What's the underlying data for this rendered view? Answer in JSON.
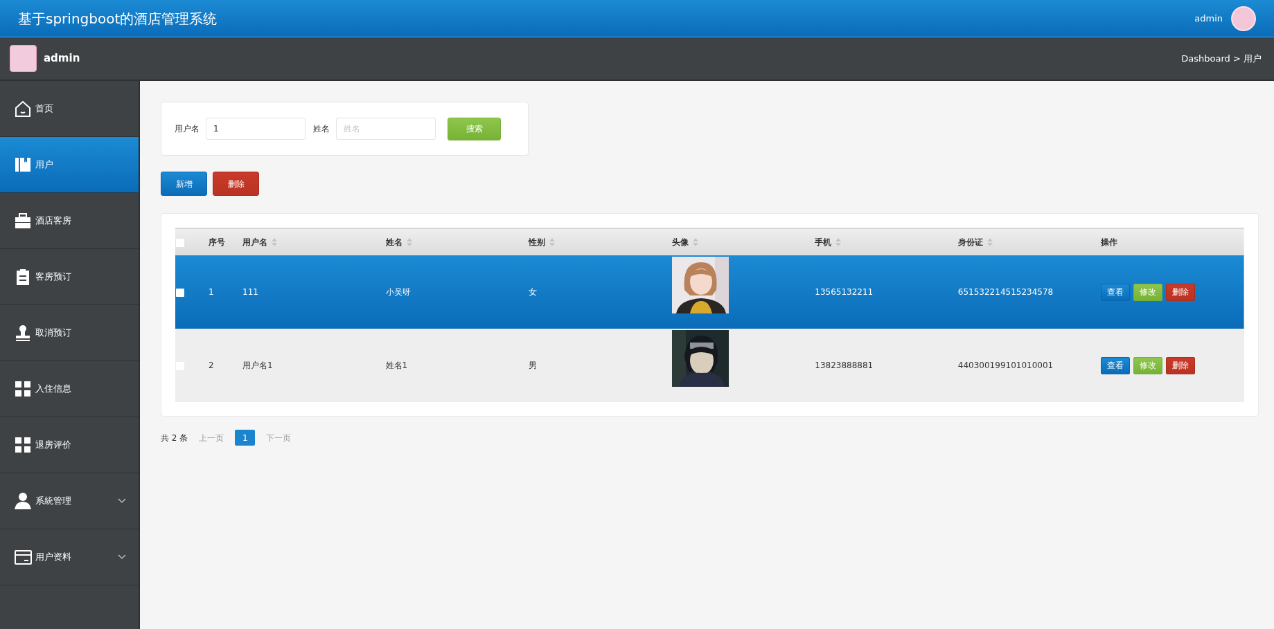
{
  "header": {
    "title": "基于springboot的酒店管理系统",
    "user": "admin"
  },
  "subbar": {
    "user": "admin",
    "breadcrumb": "Dashboard > 用户"
  },
  "sidebar": {
    "items": [
      {
        "label": "首页",
        "kind": "home",
        "selected": false,
        "expandable": false
      },
      {
        "label": "用户",
        "kind": "book",
        "selected": true,
        "expandable": false
      },
      {
        "label": "酒店客房",
        "kind": "briefcase",
        "selected": false,
        "expandable": false
      },
      {
        "label": "客房预订",
        "kind": "clipboard",
        "selected": false,
        "expandable": false
      },
      {
        "label": "取消预订",
        "kind": "stamp",
        "selected": false,
        "expandable": false
      },
      {
        "label": "入住信息",
        "kind": "grid",
        "selected": false,
        "expandable": false
      },
      {
        "label": "退房评价",
        "kind": "grid",
        "selected": false,
        "expandable": false
      },
      {
        "label": "系統管理",
        "kind": "user",
        "selected": false,
        "expandable": true
      },
      {
        "label": "用户资料",
        "kind": "card",
        "selected": false,
        "expandable": true
      }
    ]
  },
  "search": {
    "fields": [
      {
        "label": "用户名",
        "value": "1"
      },
      {
        "label": "姓名",
        "placeholder": "姓名"
      }
    ],
    "button": "搜索"
  },
  "actions": [
    {
      "label": "新增",
      "kind": "add"
    },
    {
      "label": "删除",
      "kind": "delete"
    }
  ],
  "table": {
    "select_all_checked": false,
    "columns": [
      {
        "label": "序号",
        "sortable": false
      },
      {
        "label": "用户名",
        "sortable": true
      },
      {
        "label": "姓名",
        "sortable": true
      },
      {
        "label": "性别",
        "sortable": true
      },
      {
        "label": "头像",
        "sortable": true
      },
      {
        "label": "手机",
        "sortable": true
      },
      {
        "label": "身份证",
        "sortable": true
      },
      {
        "label": "操作",
        "sortable": false
      }
    ],
    "rows": [
      {
        "selected": true,
        "checked": false,
        "cells": [
          "1",
          "111",
          "小吴呀",
          "女"
        ],
        "avatar": {
          "kind": "picture"
        },
        "phone": "13565132211",
        "id_card": "651532214515234578",
        "buttons": [
          {
            "label": "查看",
            "kind": "view"
          },
          {
            "label": "修改",
            "kind": "edit"
          },
          {
            "label": "删除",
            "kind": "delete"
          }
        ]
      },
      {
        "selected": false,
        "checked": false,
        "cells": [
          "2",
          "用户名1",
          "姓名1",
          "男"
        ],
        "avatar": {
          "kind": "picture"
        },
        "phone": "13823888881",
        "id_card": "440300199101010001",
        "buttons": [
          {
            "label": "查看",
            "kind": "view"
          },
          {
            "label": "修改",
            "kind": "edit"
          },
          {
            "label": "删除",
            "kind": "delete"
          }
        ]
      }
    ]
  },
  "pagination": {
    "total": "共 2 条",
    "prev": "上一页",
    "pages": [
      {
        "label": "1",
        "selected": true
      }
    ],
    "next": "下一页"
  }
}
